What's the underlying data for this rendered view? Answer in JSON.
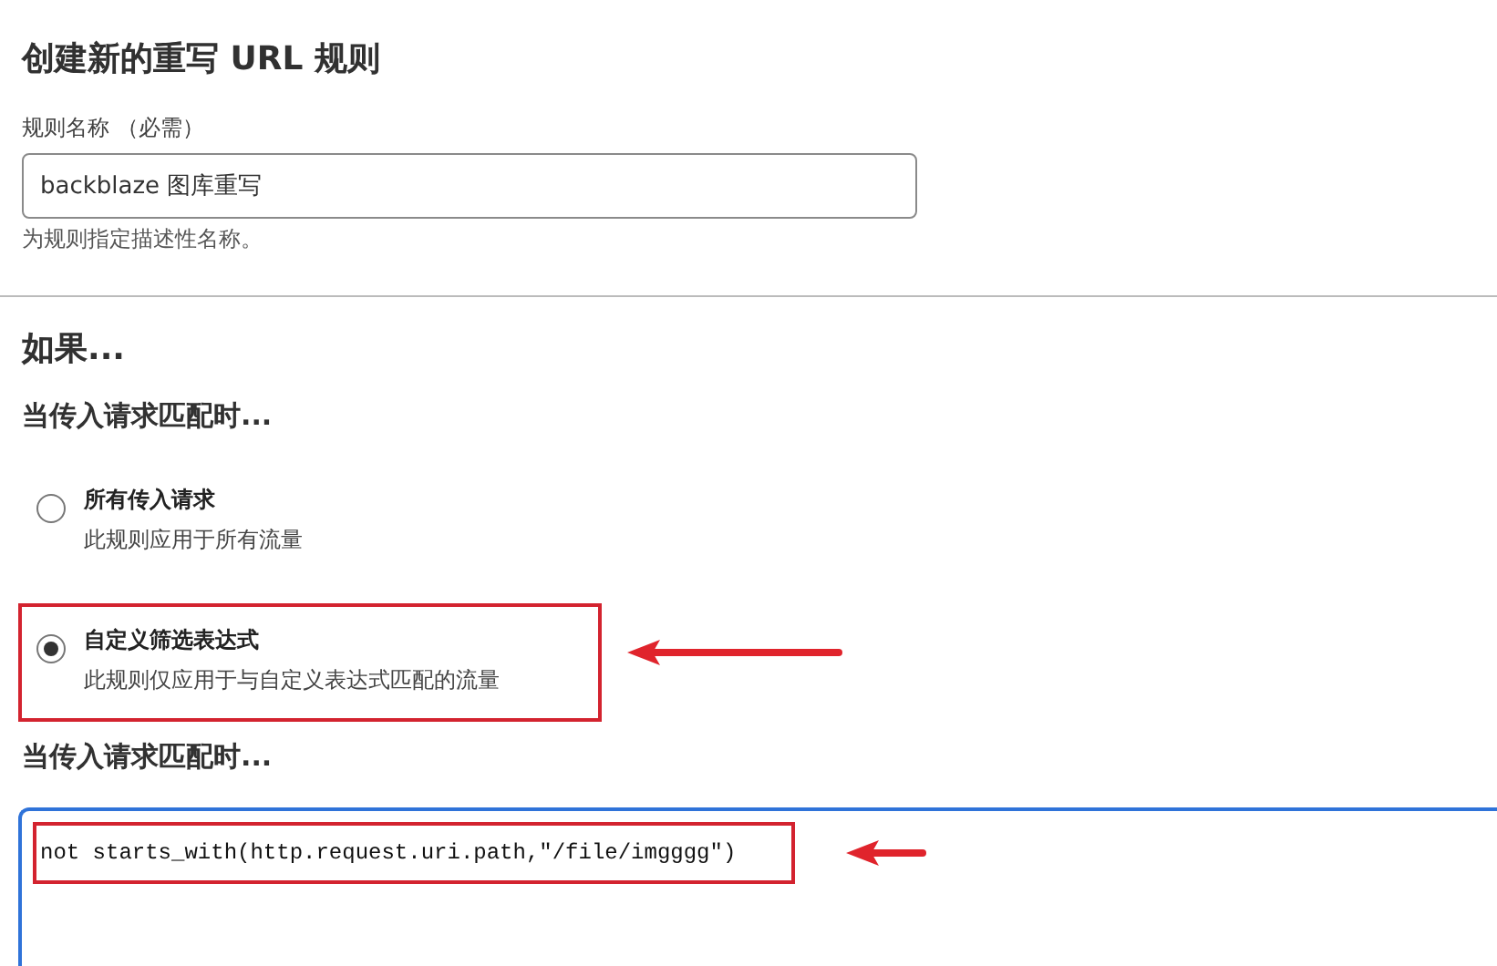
{
  "title": "创建新的重写 URL 规则",
  "name_field": {
    "label": "规则名称 （必需）",
    "value": "backblaze 图库重写",
    "hint": "为规则指定描述性名称。"
  },
  "section_title": "如果...",
  "match_heading": "当传入请求匹配时...",
  "options": [
    {
      "label": "所有传入请求",
      "description": "此规则应用于所有流量",
      "selected": false,
      "highlighted": false
    },
    {
      "label": "自定义筛选表达式",
      "description": "此规则仅应用于与自定义表达式匹配的流量",
      "selected": true,
      "highlighted": true
    }
  ],
  "expression_heading": "当传入请求匹配时...",
  "expression": {
    "value": "not starts_with(http.request.uri.path,\"/file/imgggg\")"
  }
}
